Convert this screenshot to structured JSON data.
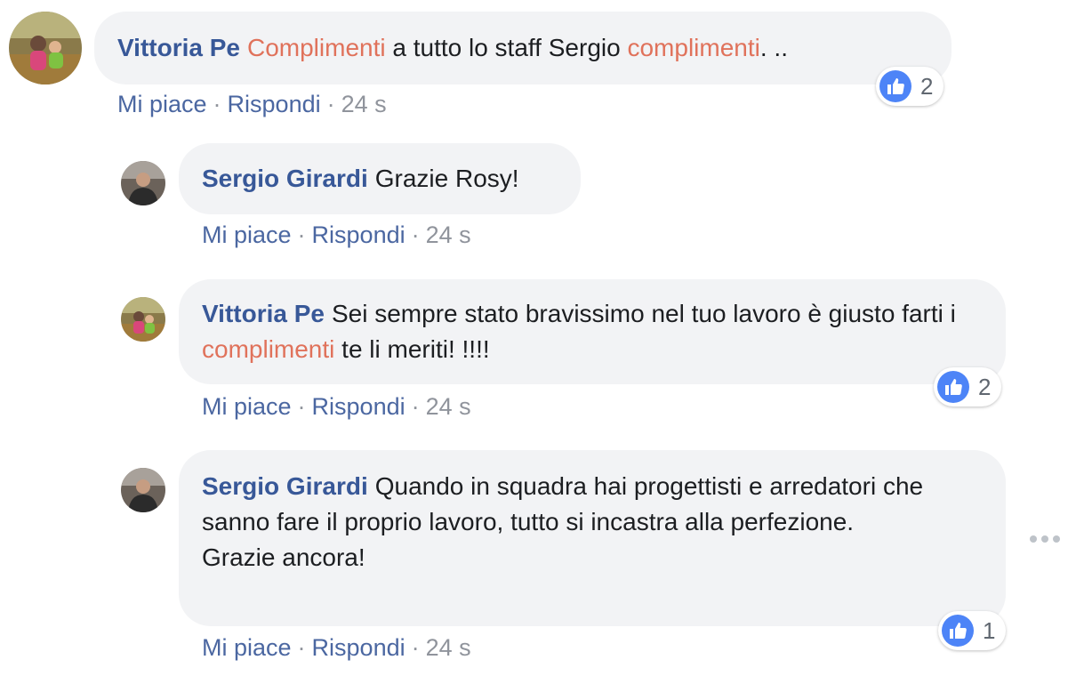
{
  "comments": [
    {
      "author": "Vittoria Pe",
      "text_parts": [
        "Complimenti",
        " a tutto lo staff Sergio ",
        "complimenti",
        ". .."
      ],
      "like_label": "Mi piace",
      "reply_label": "Rispondi",
      "separator": "·",
      "time": "24 s",
      "reaction_count": "2"
    },
    {
      "author": "Sergio Girardi",
      "text": "Grazie Rosy!",
      "like_label": "Mi piace",
      "reply_label": "Rispondi",
      "separator": "·",
      "time": "24 s"
    },
    {
      "author": "Vittoria Pe",
      "text_parts": [
        "Sei sempre stato bravissimo nel tuo lavoro è giusto farti i ",
        "complimenti",
        " te li meriti! !!!!"
      ],
      "like_label": "Mi piace",
      "reply_label": "Rispondi",
      "separator": "·",
      "time": "24 s",
      "reaction_count": "2"
    },
    {
      "author": "Sergio Girardi",
      "text_lines": [
        "Quando in squadra hai progettisti e arredatori che sanno fare il proprio lavoro, tutto si incastra alla perfezione.",
        "Grazie ancora!"
      ],
      "like_label": "Mi piace",
      "reply_label": "Rispondi",
      "separator": "·",
      "time": "24 s",
      "reaction_count": "1"
    }
  ],
  "colors": {
    "author": "#385898",
    "highlight": "#e0725b",
    "bubble": "#f2f3f5",
    "like_badge": "#4d84f7",
    "meta": "#90949c"
  },
  "icons": {
    "reaction": "thumbs-up-icon",
    "more": "more-options-icon"
  }
}
